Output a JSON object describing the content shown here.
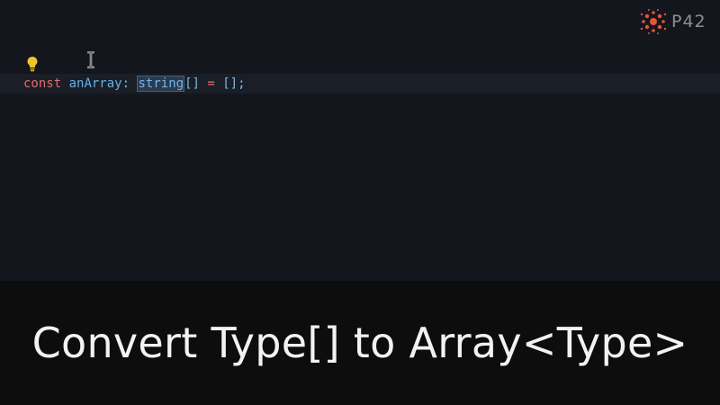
{
  "logo": {
    "text": "P42",
    "accent": "#e0553b"
  },
  "code": {
    "keyword": "const",
    "identifier": "anArray",
    "colon": ":",
    "type_selected": "string",
    "brackets": "[]",
    "assign": "=",
    "value": "[];"
  },
  "icons": {
    "lightbulb": "lightbulb-icon",
    "cursor": "text-cursor-icon"
  },
  "caption": {
    "title": "Convert Type[] to Array<Type>"
  },
  "colors": {
    "editor_bg": "#13161d",
    "caption_bg": "#0d0d0d",
    "keyword": "#e06c6c",
    "identifier": "#61b0ec",
    "bulb": "#f2c12e"
  }
}
